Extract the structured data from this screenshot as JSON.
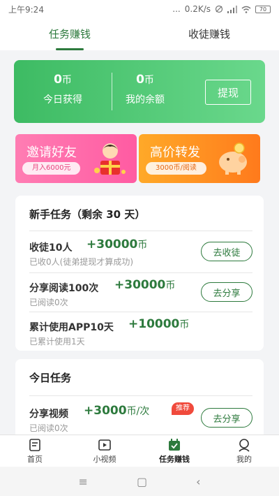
{
  "status_bar": {
    "time": "上午9:24",
    "dots": "...",
    "speed": "0.2K/s",
    "battery": "70"
  },
  "top_tabs": [
    {
      "label": "任务赚钱",
      "active": true
    },
    {
      "label": "收徒赚钱",
      "active": false
    }
  ],
  "balance": {
    "today_amount": "0",
    "today_unit": "币",
    "today_label": "今日获得",
    "total_amount": "0",
    "total_unit": "币",
    "total_label": "我的余额",
    "withdraw_label": "提现"
  },
  "banners": {
    "invite": {
      "title": "邀请好友",
      "pill": "月入6000元"
    },
    "share": {
      "title": "高价转发",
      "pill": "3000币/阅读"
    }
  },
  "newbie_tasks": {
    "title": "新手任务（剩余 30 天）",
    "items": [
      {
        "name": "收徒10人",
        "reward": "+30000",
        "unit": "币",
        "sub": "已收0人(徒弟提现才算成功)",
        "button": "去收徒"
      },
      {
        "name": "分享阅读100次",
        "reward": "+30000",
        "unit": "币",
        "sub": "已阅读0次",
        "button": "去分享"
      },
      {
        "name": "累计使用APP10天",
        "reward": "+10000",
        "unit": "币",
        "sub": "已累计使用1天"
      }
    ]
  },
  "daily_tasks": {
    "title": "今日任务",
    "items": [
      {
        "name": "分享视频",
        "reward": "+3000",
        "unit": "币/次",
        "sub": "已阅读0次",
        "badge": "推荐",
        "button": "去分享"
      }
    ]
  },
  "bottom_nav": [
    {
      "label": "首页",
      "icon": "home-doc-icon",
      "active": false
    },
    {
      "label": "小视频",
      "icon": "video-play-icon",
      "active": false
    },
    {
      "label": "任务赚钱",
      "icon": "calendar-task-icon",
      "active": true
    },
    {
      "label": "我的",
      "icon": "user-icon",
      "active": false
    }
  ],
  "system_nav": {
    "menu": "≡",
    "home": "▢",
    "back": "‹"
  },
  "colors": {
    "brand_green": "#2d7a3d",
    "card_green": "#3dbb63",
    "invite_pink": "#ff5ba2",
    "share_orange": "#ff7a1c",
    "badge_red": "#f04a3c"
  }
}
